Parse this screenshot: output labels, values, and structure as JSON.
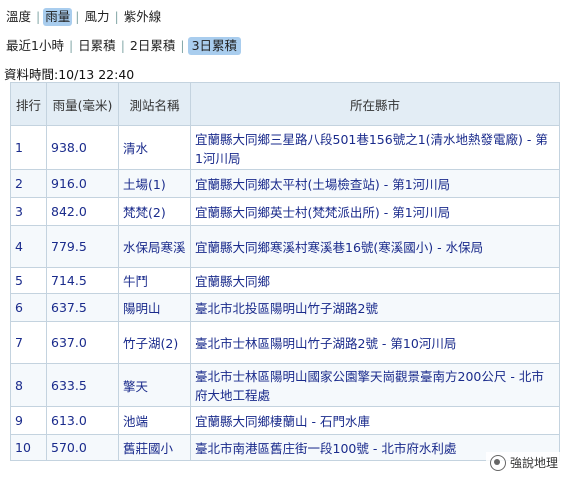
{
  "type_tabs": [
    {
      "label": "溫度",
      "active": false
    },
    {
      "label": "雨量",
      "active": true
    },
    {
      "label": "風力",
      "active": false
    },
    {
      "label": "紫外線",
      "active": false
    }
  ],
  "period_tabs": [
    {
      "label": "最近1小時",
      "active": false
    },
    {
      "label": "日累積",
      "active": false
    },
    {
      "label": "2日累積",
      "active": false
    },
    {
      "label": "3日累積",
      "active": true
    }
  ],
  "update_time": "資料時間:10/13 22:40",
  "table": {
    "headers": [
      "排行",
      "雨量(毫米)",
      "測站名稱",
      "所在縣市"
    ],
    "rows": [
      {
        "rank": "1",
        "rain": "938.0",
        "station": "清水",
        "location": "宜蘭縣大同鄉三星路八段501巷156號之1(清水地熱發電廠) - 第1河川局"
      },
      {
        "rank": "2",
        "rain": "916.0",
        "station": "土場(1)",
        "location": "宜蘭縣大同鄉太平村(土場檢查站) - 第1河川局"
      },
      {
        "rank": "3",
        "rain": "842.0",
        "station": "梵梵(2)",
        "location": "宜蘭縣大同鄉英士村(梵梵派出所) - 第1河川局"
      },
      {
        "rank": "4",
        "rain": "779.5",
        "station": "水保局寒溪",
        "location": "宜蘭縣大同鄉寒溪村寒溪巷16號(寒溪國小) - 水保局"
      },
      {
        "rank": "5",
        "rain": "714.5",
        "station": "牛鬥",
        "location": "宜蘭縣大同鄉"
      },
      {
        "rank": "6",
        "rain": "637.5",
        "station": "陽明山",
        "location": "臺北市北投區陽明山竹子湖路2號"
      },
      {
        "rank": "7",
        "rain": "637.0",
        "station": "竹子湖(2)",
        "location": "臺北市士林區陽明山竹子湖路2號 - 第10河川局"
      },
      {
        "rank": "8",
        "rain": "633.5",
        "station": "擎天",
        "location": "臺北市士林區陽明山國家公園擎天崗觀景臺南方200公尺 - 北市府大地工程處"
      },
      {
        "rank": "9",
        "rain": "613.0",
        "station": "池端",
        "location": "宜蘭縣大同鄉棲蘭山 - 石門水庫"
      },
      {
        "rank": "10",
        "rain": "570.0",
        "station": "舊莊國小",
        "location": "臺北市南港區舊庄街一段100號 - 北市府水利處"
      }
    ]
  },
  "watermark": "強說地理"
}
